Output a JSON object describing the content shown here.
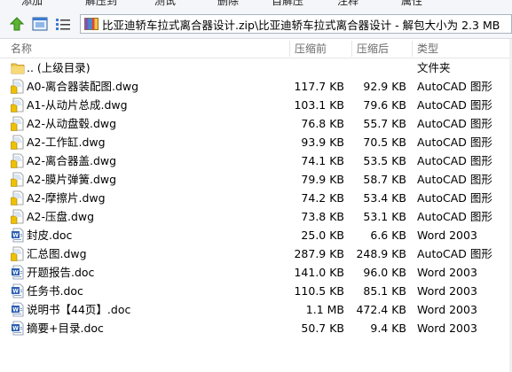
{
  "toolbar": {
    "items": [
      "添加",
      "解压到",
      "测试",
      "删除",
      "自解压",
      "注释",
      "属性"
    ]
  },
  "address": {
    "path": "比亚迪轿车拉式离合器设计.zip\\比亚迪轿车拉式离合器设计 - 解包大小为 2.3 MB"
  },
  "columns": {
    "name": "名称",
    "size": "压缩前",
    "packed": "压缩后",
    "type": "类型"
  },
  "files": [
    {
      "name": ".. (上级目录)",
      "size": "",
      "packed": "",
      "type": "文件夹",
      "icon": "folder-icon"
    },
    {
      "name": "A0-离合器装配图.dwg",
      "size": "117.7 KB",
      "packed": "92.9 KB",
      "type": "AutoCAD 图形",
      "icon": "dwg-file-icon"
    },
    {
      "name": "A1-从动片总成.dwg",
      "size": "103.1 KB",
      "packed": "79.6 KB",
      "type": "AutoCAD 图形",
      "icon": "dwg-file-icon"
    },
    {
      "name": "A2-从动盘毂.dwg",
      "size": "76.8 KB",
      "packed": "55.7 KB",
      "type": "AutoCAD 图形",
      "icon": "dwg-file-icon"
    },
    {
      "name": "A2-工作缸.dwg",
      "size": "93.9 KB",
      "packed": "70.5 KB",
      "type": "AutoCAD 图形",
      "icon": "dwg-file-icon"
    },
    {
      "name": "A2-离合器盖.dwg",
      "size": "74.1 KB",
      "packed": "53.5 KB",
      "type": "AutoCAD 图形",
      "icon": "dwg-file-icon"
    },
    {
      "name": "A2-膜片弹簧.dwg",
      "size": "79.9 KB",
      "packed": "58.7 KB",
      "type": "AutoCAD 图形",
      "icon": "dwg-file-icon"
    },
    {
      "name": "A2-摩擦片.dwg",
      "size": "74.2 KB",
      "packed": "53.4 KB",
      "type": "AutoCAD 图形",
      "icon": "dwg-file-icon"
    },
    {
      "name": "A2-压盘.dwg",
      "size": "73.8 KB",
      "packed": "53.1 KB",
      "type": "AutoCAD 图形",
      "icon": "dwg-file-icon"
    },
    {
      "name": "封皮.doc",
      "size": "25.0 KB",
      "packed": "6.6 KB",
      "type": "Word 2003",
      "icon": "word-file-icon"
    },
    {
      "name": "汇总图.dwg",
      "size": "287.9 KB",
      "packed": "248.9 KB",
      "type": "AutoCAD 图形",
      "icon": "dwg-file-icon"
    },
    {
      "name": "开题报告.doc",
      "size": "141.0 KB",
      "packed": "96.0 KB",
      "type": "Word 2003",
      "icon": "word-file-icon"
    },
    {
      "name": "任务书.doc",
      "size": "110.5 KB",
      "packed": "85.1 KB",
      "type": "Word 2003",
      "icon": "word-file-icon"
    },
    {
      "name": "说明书【44页】.doc",
      "size": "1.1 MB",
      "packed": "472.4 KB",
      "type": "Word 2003",
      "icon": "word-file-icon"
    },
    {
      "name": "摘要+目录.doc",
      "size": "50.7 KB",
      "packed": "9.4 KB",
      "type": "Word 2003",
      "icon": "word-file-icon"
    }
  ]
}
